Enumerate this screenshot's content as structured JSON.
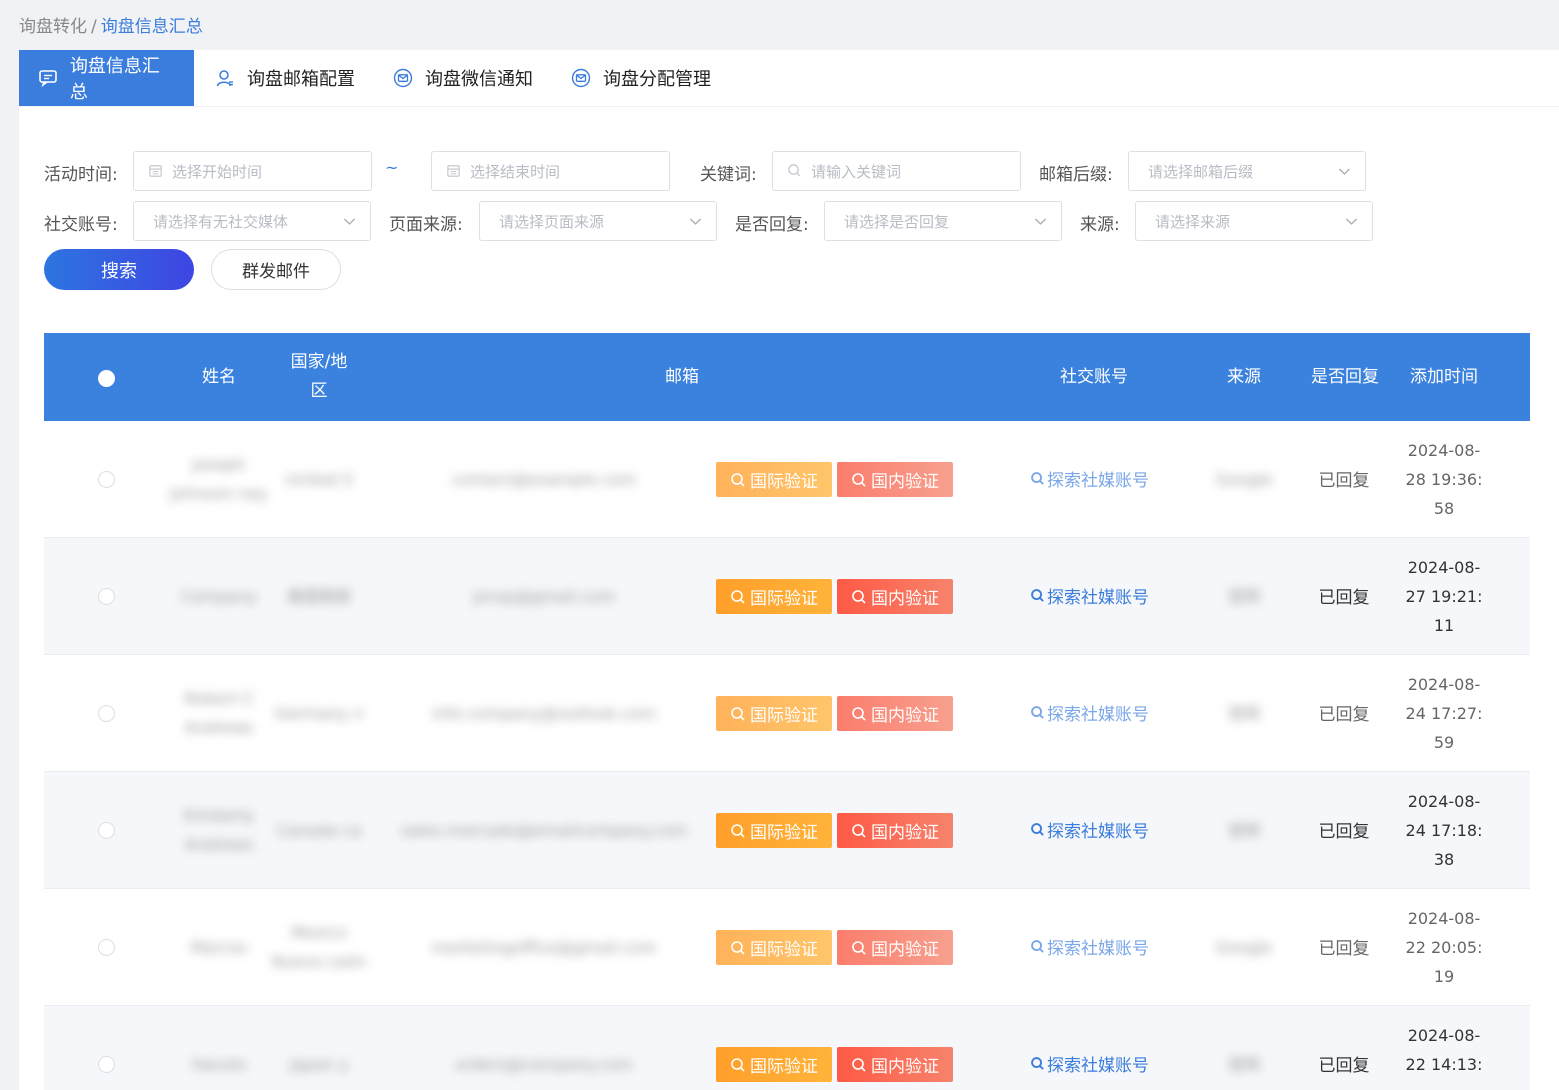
{
  "breadcrumb": {
    "parent": "询盘转化",
    "separator": "/",
    "current": "询盘信息汇总"
  },
  "tabs": [
    {
      "label": "询盘信息汇总",
      "icon": "message-icon"
    },
    {
      "label": "询盘邮箱配置",
      "icon": "user-icon"
    },
    {
      "label": "询盘微信通知",
      "icon": "mail-icon"
    },
    {
      "label": "询盘分配管理",
      "icon": "mail-icon"
    }
  ],
  "filters": {
    "activity_time_label": "活动时间:",
    "start_placeholder": "选择开始时间",
    "range_separator": "~",
    "end_placeholder": "选择结束时间",
    "keyword_label": "关键词:",
    "keyword_placeholder": "请输入关键词",
    "email_suffix_label": "邮箱后缀:",
    "email_suffix_placeholder": "请选择邮箱后缀",
    "social_label": "社交账号:",
    "social_placeholder": "请选择有无社交媒体",
    "page_source_label": "页面来源:",
    "page_source_placeholder": "请选择页面来源",
    "replied_label": "是否回复:",
    "replied_placeholder": "请选择是否回复",
    "source_label": "来源:",
    "source_placeholder": "请选择来源"
  },
  "actions": {
    "search": "搜索",
    "mass_mail": "群发邮件"
  },
  "table": {
    "headers": {
      "name": "姓名",
      "country_line1": "国家/地",
      "country_line2": "区",
      "email": "邮箱",
      "social": "社交账号",
      "source": "来源",
      "replied": "是否回复",
      "added_time": "添加时间"
    },
    "intl_verify": "国际验证",
    "domestic_verify": "国内验证",
    "explore_social": "探索社媒账号",
    "rows": [
      {
        "name": "Joseph Johnson ney",
        "country": "United S",
        "email": "contact@example.com",
        "source": "Google",
        "replied": "已回复",
        "time_l1": "2024-08-",
        "time_l2": "28 19:36:",
        "time_l3": "58"
      },
      {
        "name": "Company",
        "country": "美国南部",
        "email": "jonsp@gmail.com",
        "source": "官网",
        "replied": "已回复",
        "time_l1": "2024-08-",
        "time_l2": "27 19:21:",
        "time_l3": "11"
      },
      {
        "name": "Robert C Andrews",
        "country": "Germany n",
        "email": "info.company@outlook.com",
        "source": "官网",
        "replied": "已回复",
        "time_l1": "2024-08-",
        "time_l2": "24 17:27:",
        "time_l3": "59"
      },
      {
        "name": "Kimberly Andrews",
        "country": "Canada ca",
        "email": "sales.mercado@emailcompany.com",
        "source": "官网",
        "replied": "已回复",
        "time_l1": "2024-08-",
        "time_l2": "24 17:18:",
        "time_l3": "38"
      },
      {
        "name": "Marcos",
        "country": "Mexico Nuevo León",
        "email": "marketingoffice@gmail.com",
        "source": "Google",
        "replied": "已回复",
        "time_l1": "2024-08-",
        "time_l2": "22 20:05:",
        "time_l3": "19"
      },
      {
        "name": "Haruto",
        "country": "Japan y",
        "email": "orders@company.com",
        "source": "官网",
        "replied": "已回复",
        "time_l1": "2024-08-",
        "time_l2": "22 14:13:",
        "time_l3": ""
      }
    ]
  }
}
